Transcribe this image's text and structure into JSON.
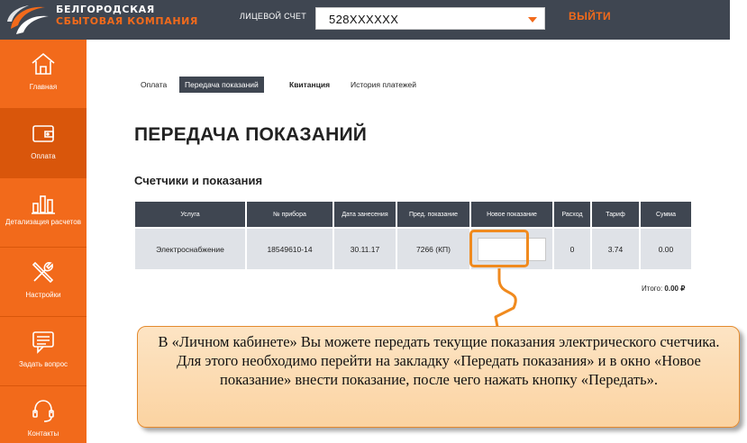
{
  "header": {
    "brand_line1": "БЕЛГОРОДСКАЯ",
    "brand_line2": "СБЫТОВАЯ КОМПАНИЯ",
    "account_label": "ЛИЦЕВОЙ СЧЕТ",
    "account_value": "528XXXXXX",
    "logout_label": "ВЫЙТИ",
    "colors": {
      "bar": "#3f4651",
      "accent": "#f26a1b"
    }
  },
  "sidebar": {
    "items": [
      {
        "label": "Главная",
        "icon": "home-icon"
      },
      {
        "label": "Оплата",
        "icon": "wallet-icon",
        "active": true
      },
      {
        "label": "Детализация расчетов",
        "icon": "bar-chart-icon"
      },
      {
        "label": "Настройки",
        "icon": "tools-icon"
      },
      {
        "label": "Задать вопрос",
        "icon": "chat-icon"
      },
      {
        "label": "Контакты",
        "icon": "headset-icon"
      }
    ]
  },
  "tabs": [
    {
      "label": "Оплата"
    },
    {
      "label": "Передача показаний",
      "active": true
    },
    {
      "label": "Квитанция"
    },
    {
      "label": "История платежей"
    }
  ],
  "page_title": "ПЕРЕДАЧА ПОКАЗАНИЙ",
  "section_title": "Счетчики и показания",
  "table": {
    "headers": [
      "Услуга",
      "№ прибора",
      "Дата занесения",
      "Пред. показание",
      "Новое показание",
      "Расход",
      "Тариф",
      "Сумма"
    ],
    "row": [
      "Электроснабжение",
      "18549610-14",
      "30.11.17",
      "7266 (КП)",
      "",
      "0",
      "3.74",
      "0.00"
    ],
    "new_reading_placeholder": ""
  },
  "total": {
    "label": "Итого:",
    "value": "0.00 ₽"
  },
  "callout": {
    "text": "В «Личном кабинете» Вы можете передать текущие показания электрического счетчика. Для этого необходимо перейти на закладку «Передать показания» и в окно «Новое показание» внести показание, после чего нажать кнопку «Передать»."
  }
}
